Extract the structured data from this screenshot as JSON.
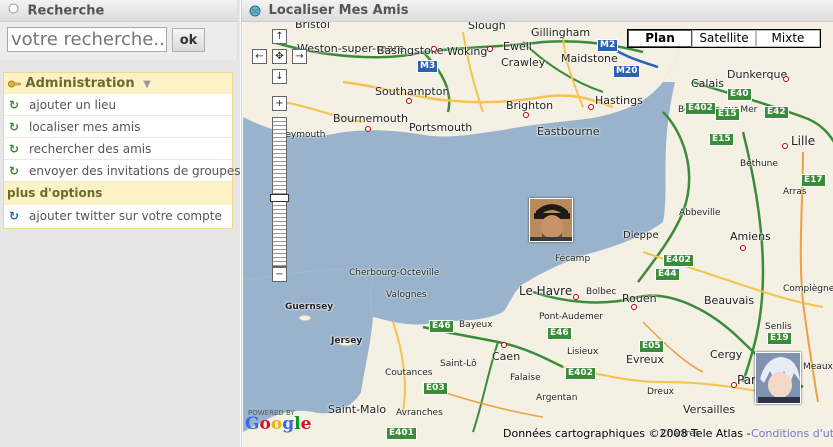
{
  "search": {
    "title": "Recherche",
    "placeholder": "votre recherche...",
    "button_label": "ok"
  },
  "admin": {
    "title": "Administration",
    "items": [
      {
        "label": "ajouter un lieu"
      },
      {
        "label": "localiser mes amis"
      },
      {
        "label": "rechercher des amis"
      },
      {
        "label": "envoyer des invitations de groupes"
      }
    ],
    "more_title": "plus d'options",
    "more_items": [
      {
        "label": "ajouter twitter sur votre compte"
      }
    ]
  },
  "map_panel": {
    "title": "Localiser Mes Amis",
    "map_types": [
      "Plan",
      "Satellite",
      "Mixte"
    ],
    "active_map_type": "Plan",
    "copyright": "Données cartographiques ©2008 Tele Atlas -",
    "terms": "Conditions d'utilisation",
    "logo": "Google",
    "powered_by": "POWERED BY"
  },
  "cities": {
    "bristol": "Bristol",
    "weston": "Weston-super-mare",
    "basingstoke": "Basingstoke",
    "woking": "Woking",
    "slough": "Slough",
    "ewell": "Ewell",
    "crawley": "Crawley",
    "gillingham": "Gillingham",
    "maidstone": "Maidstone",
    "southampton": "Southampton",
    "bournemouth": "Bournemouth",
    "portsmouth": "Portsmouth",
    "weymouth": "Weymouth",
    "brighton": "Brighton",
    "eastbourne": "Eastbourne",
    "hastings": "Hastings",
    "calais": "Calais",
    "dunkerque": "Dunkerque",
    "boulogne": "Boulogne-sur-Mer",
    "lille": "Lille",
    "bethune": "Béthune",
    "arras": "Arras",
    "dieppe": "Dieppe",
    "amiens": "Amiens",
    "fecamp": "Fécamp",
    "lehavre": "Le Havre",
    "bolbec": "Bolbec",
    "rouen": "Rouen",
    "beauvais": "Beauvais",
    "cherbourg": "Cherbourg-Octeville",
    "valognes": "Valognes",
    "guernsey": "Guernsey",
    "jersey": "Jersey",
    "bayeux": "Bayeux",
    "caen": "Caen",
    "lisieux": "Lisieux",
    "evreux": "Evreux",
    "cergy": "Cergy",
    "paris": "Paris",
    "coutances": "Coutances",
    "saintlo": "Saint-Lô",
    "falaise": "Falaise",
    "argentan": "Argentan",
    "avranches": "Avranches",
    "saintmalo": "Saint-Malo",
    "versailles": "Versailles",
    "dreux": "Dreux",
    "chartres": "Chartres",
    "pontaudemer": "Pont-Audemer",
    "abbeville": "Abbeville",
    "compiegne": "Compiègne",
    "senlis": "Senlis",
    "meaux": "Meaux"
  },
  "roads": {
    "m3": "M3",
    "m2": "M2",
    "m20": "M20",
    "e40": "E40",
    "e42": "E42",
    "e15": "E15",
    "e402": "E402",
    "e44": "E44",
    "e46": "E46",
    "e05": "E05",
    "e03": "E03",
    "e401": "E401",
    "e19": "E19",
    "e17": "E17"
  },
  "colors": {
    "sea": "#99b3cc",
    "land": "#f4f0e4",
    "motorway": "#3b8c3a",
    "primary_road": "#f5c350",
    "secondary_road": "#f0a040",
    "accent_yellow": "#fdf1c6"
  }
}
